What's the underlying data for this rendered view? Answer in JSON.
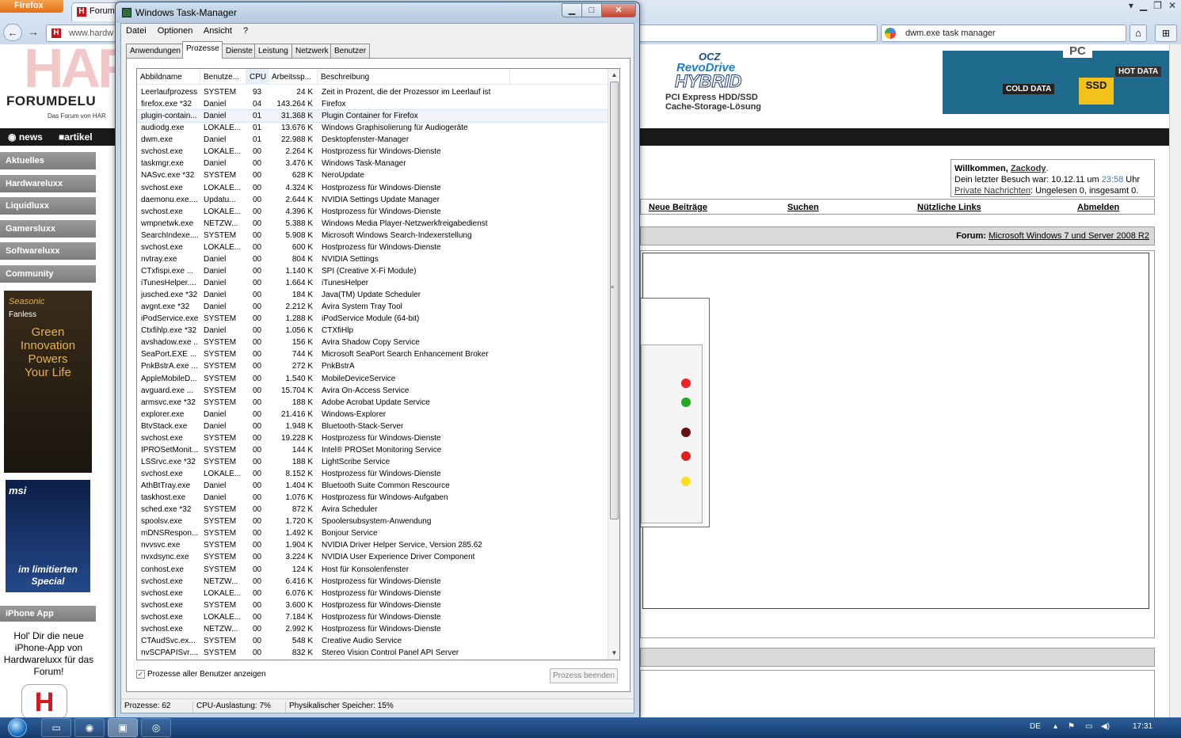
{
  "firefox": {
    "menu_button": "Firefox",
    "tab_title": "Forum",
    "url": "www.hardw",
    "search_query": "dwm.exe task manager"
  },
  "site": {
    "logo_big": "HAR",
    "logo_name": "FORUMDELU",
    "logo_sub": "Das Forum von HAR",
    "nav": [
      "news",
      "artikel"
    ],
    "sidebar": [
      "Aktuelles",
      "Hardwareluxx",
      "Liquidluxx",
      "Gamersluxx",
      "Softwareluxx",
      "Community"
    ],
    "ad1": {
      "brand": "Seasonic",
      "sub": "Fanless",
      "text": [
        "Green",
        "Innovation",
        "Powers",
        "Your Life"
      ]
    },
    "ad2": {
      "brand": "msi",
      "line1": "im limitierten",
      "line2": "Special"
    },
    "iphone_header": "iPhone App",
    "iphone_text": "Hol' Dir die neue iPhone-App von Hardwareluxx für das Forum!",
    "iphone_logo": "H",
    "banner": {
      "ocz": "OCZ",
      "revo": "RevoDrive",
      "hybrid": "HYBRID",
      "line1": "PCI Express HDD/SSD",
      "line2": "Cache-Storage-Lösung",
      "hot": "HOT DATA",
      "cold": "COLD DATA",
      "ssd": "SSD",
      "pc": "PC"
    },
    "welcome": {
      "greeting": "Willkommen,",
      "user": "Zackody",
      "last_visit": "Dein letzter Besuch war: 10.12.11 um",
      "time": "23:58",
      "suffix": "Uhr",
      "pm_link": "Private Nachrichten",
      "pm_status": ": Ungelesen 0, insgesamt 0."
    },
    "links": [
      "Neue Beiträge",
      "Suchen",
      "Nützliche Links",
      "Abmelden"
    ],
    "forum_label": "Forum:",
    "forum_name": "Microsoft Windows 7 und Server 2008 R2"
  },
  "taskmanager": {
    "title": "Windows Task-Manager",
    "menu": [
      "Datei",
      "Optionen",
      "Ansicht",
      "?"
    ],
    "tabs": [
      "Anwendungen",
      "Prozesse",
      "Dienste",
      "Leistung",
      "Netzwerk",
      "Benutzer"
    ],
    "active_tab": "Prozesse",
    "columns": [
      "Abbildname",
      "Benutze...",
      "CPU",
      "Arbeitssp...",
      "Beschreibung"
    ],
    "processes": [
      [
        "Leerlaufprozess",
        "SYSTEM",
        "93",
        "24 K",
        "Zeit in Prozent, die der Prozessor im Leerlauf ist"
      ],
      [
        "firefox.exe *32",
        "Daniel",
        "04",
        "143.264 K",
        "Firefox"
      ],
      [
        "plugin-contain...",
        "Daniel",
        "01",
        "31.368 K",
        "Plugin Container for Firefox"
      ],
      [
        "audiodg.exe",
        "LOKALE...",
        "01",
        "13.676 K",
        "Windows Graphisolierung für Audiogeräte"
      ],
      [
        "dwm.exe",
        "Daniel",
        "01",
        "22.988 K",
        "Desktopfenster-Manager"
      ],
      [
        "svchost.exe",
        "LOKALE...",
        "00",
        "2.264 K",
        "Hostprozess für Windows-Dienste"
      ],
      [
        "taskmgr.exe",
        "Daniel",
        "00",
        "3.476 K",
        "Windows Task-Manager"
      ],
      [
        "NASvc.exe *32",
        "SYSTEM",
        "00",
        "628 K",
        "NeroUpdate"
      ],
      [
        "svchost.exe",
        "LOKALE...",
        "00",
        "4.324 K",
        "Hostprozess für Windows-Dienste"
      ],
      [
        "daemonu.exe....",
        "Updatu...",
        "00",
        "2.644 K",
        "NVIDIA Settings Update Manager"
      ],
      [
        "svchost.exe",
        "LOKALE...",
        "00",
        "4.396 K",
        "Hostprozess für Windows-Dienste"
      ],
      [
        "wmpnetwk.exe",
        "NETZW...",
        "00",
        "5.388 K",
        "Windows Media Player-Netzwerkfreigabedienst"
      ],
      [
        "SearchIndexe....",
        "SYSTEM",
        "00",
        "5.908 K",
        "Microsoft Windows Search-Indexerstellung"
      ],
      [
        "svchost.exe",
        "LOKALE...",
        "00",
        "600 K",
        "Hostprozess für Windows-Dienste"
      ],
      [
        "nvtray.exe",
        "Daniel",
        "00",
        "804 K",
        "NVIDIA Settings"
      ],
      [
        "CTxfispi.exe ...",
        "Daniel",
        "00",
        "1.140 K",
        "SPI (Creative X-Fi Module)"
      ],
      [
        "iTunesHelper....",
        "Daniel",
        "00",
        "1.664 K",
        "iTunesHelper"
      ],
      [
        "jusched.exe *32",
        "Daniel",
        "00",
        "184 K",
        "Java(TM) Update Scheduler"
      ],
      [
        "avgnt.exe *32",
        "Daniel",
        "00",
        "2.212 K",
        "Avira System Tray Tool"
      ],
      [
        "iPodService.exe",
        "SYSTEM",
        "00",
        "1.288 K",
        "iPodService Module (64-bit)"
      ],
      [
        "Ctxfihlp.exe *32",
        "Daniel",
        "00",
        "1.056 K",
        "CTXfiHlp"
      ],
      [
        "avshadow.exe ...",
        "SYSTEM",
        "00",
        "156 K",
        "Avira Shadow Copy Service"
      ],
      [
        "SeaPort.EXE ...",
        "SYSTEM",
        "00",
        "744 K",
        "Microsoft SeaPort Search Enhancement Broker"
      ],
      [
        "PnkBstrA.exe ...",
        "SYSTEM",
        "00",
        "272 K",
        "PnkBstrA"
      ],
      [
        "AppleMobileD...",
        "SYSTEM",
        "00",
        "1.540 K",
        "MobileDeviceService"
      ],
      [
        "avguard.exe ...",
        "SYSTEM",
        "00",
        "15.704 K",
        "Avira On-Access Service"
      ],
      [
        "armsvc.exe *32",
        "SYSTEM",
        "00",
        "188 K",
        "Adobe Acrobat Update Service"
      ],
      [
        "explorer.exe",
        "Daniel",
        "00",
        "21.416 K",
        "Windows-Explorer"
      ],
      [
        "BtvStack.exe",
        "Daniel",
        "00",
        "1.948 K",
        "Bluetooth-Stack-Server"
      ],
      [
        "svchost.exe",
        "SYSTEM",
        "00",
        "19.228 K",
        "Hostprozess für Windows-Dienste"
      ],
      [
        "IPROSetMonit...",
        "SYSTEM",
        "00",
        "144 K",
        "Intel® PROSet Monitoring Service"
      ],
      [
        "LSSrvc.exe *32",
        "SYSTEM",
        "00",
        "188 K",
        "LightScribe Service"
      ],
      [
        "svchost.exe",
        "LOKALE...",
        "00",
        "8.152 K",
        "Hostprozess für Windows-Dienste"
      ],
      [
        "AthBtTray.exe",
        "Daniel",
        "00",
        "1.404 K",
        "Bluetooth Suite Common Rescource"
      ],
      [
        "taskhost.exe",
        "Daniel",
        "00",
        "1.076 K",
        "Hostprozess für Windows-Aufgaben"
      ],
      [
        "sched.exe *32",
        "SYSTEM",
        "00",
        "872 K",
        "Avira Scheduler"
      ],
      [
        "spoolsv.exe",
        "SYSTEM",
        "00",
        "1.720 K",
        "Spoolersubsystem-Anwendung"
      ],
      [
        "mDNSRespon...",
        "SYSTEM",
        "00",
        "1.492 K",
        "Bonjour Service"
      ],
      [
        "nvvsvc.exe",
        "SYSTEM",
        "00",
        "1.904 K",
        "NVIDIA Driver Helper Service, Version 285.62"
      ],
      [
        "nvxdsync.exe",
        "SYSTEM",
        "00",
        "3.224 K",
        "NVIDIA User Experience Driver Component"
      ],
      [
        "conhost.exe",
        "SYSTEM",
        "00",
        "124 K",
        "Host für Konsolenfenster"
      ],
      [
        "svchost.exe",
        "NETZW...",
        "00",
        "6.416 K",
        "Hostprozess für Windows-Dienste"
      ],
      [
        "svchost.exe",
        "LOKALE...",
        "00",
        "6.076 K",
        "Hostprozess für Windows-Dienste"
      ],
      [
        "svchost.exe",
        "SYSTEM",
        "00",
        "3.600 K",
        "Hostprozess für Windows-Dienste"
      ],
      [
        "svchost.exe",
        "LOKALE...",
        "00",
        "7.184 K",
        "Hostprozess für Windows-Dienste"
      ],
      [
        "svchost.exe",
        "NETZW...",
        "00",
        "2.992 K",
        "Hostprozess für Windows-Dienste"
      ],
      [
        "CTAudSvc.ex...",
        "SYSTEM",
        "00",
        "548 K",
        "Creative Audio Service"
      ],
      [
        "nvSCPAPISvr....",
        "SYSTEM",
        "00",
        "832 K",
        "Stereo Vision Control Panel API Server"
      ]
    ],
    "selected_row": 2,
    "show_all_label": "Prozesse aller Benutzer anzeigen",
    "show_all_checked": true,
    "end_button": "Prozess beenden",
    "status": {
      "processes": "Prozesse: 62",
      "cpu": "CPU-Auslastung: 7%",
      "memory": "Physikalischer Speicher: 15%"
    }
  },
  "taskbar": {
    "language": "DE",
    "clock": "17:31"
  }
}
